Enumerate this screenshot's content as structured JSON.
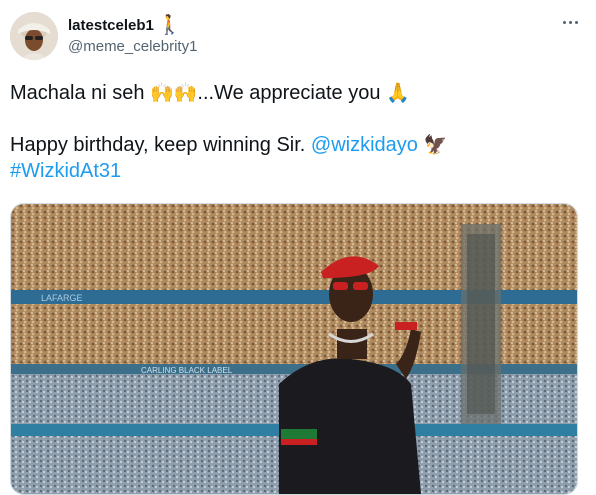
{
  "user": {
    "display_name": "latestceleb1",
    "name_emoji": "🚶",
    "handle": "@meme_celebrity1",
    "avatar_icon": "avatar-photo"
  },
  "menu": {
    "icon": "more-options-icon"
  },
  "tweet": {
    "line1_text": "Machala ni seh ",
    "line1_emoji1": "🙌🙌",
    "line1_text2": "...We appreciate you ",
    "line1_emoji2": "🙏",
    "line2_text": "Happy birthday, keep winning Sir. ",
    "mention": "@wizkidayo",
    "line2_emoji": "🦅",
    "hashtag": "#WizkidAt31"
  },
  "media": {
    "banner_text1": "CARLING BLACK LABEL",
    "banner_text2": "LAFARGE",
    "colors": {
      "crowd": "#b08a5f",
      "blue_band": "#2f6c93",
      "sweater": "#1b1a1e",
      "beret": "#c92121",
      "stripe_green": "#1f7a35"
    }
  }
}
